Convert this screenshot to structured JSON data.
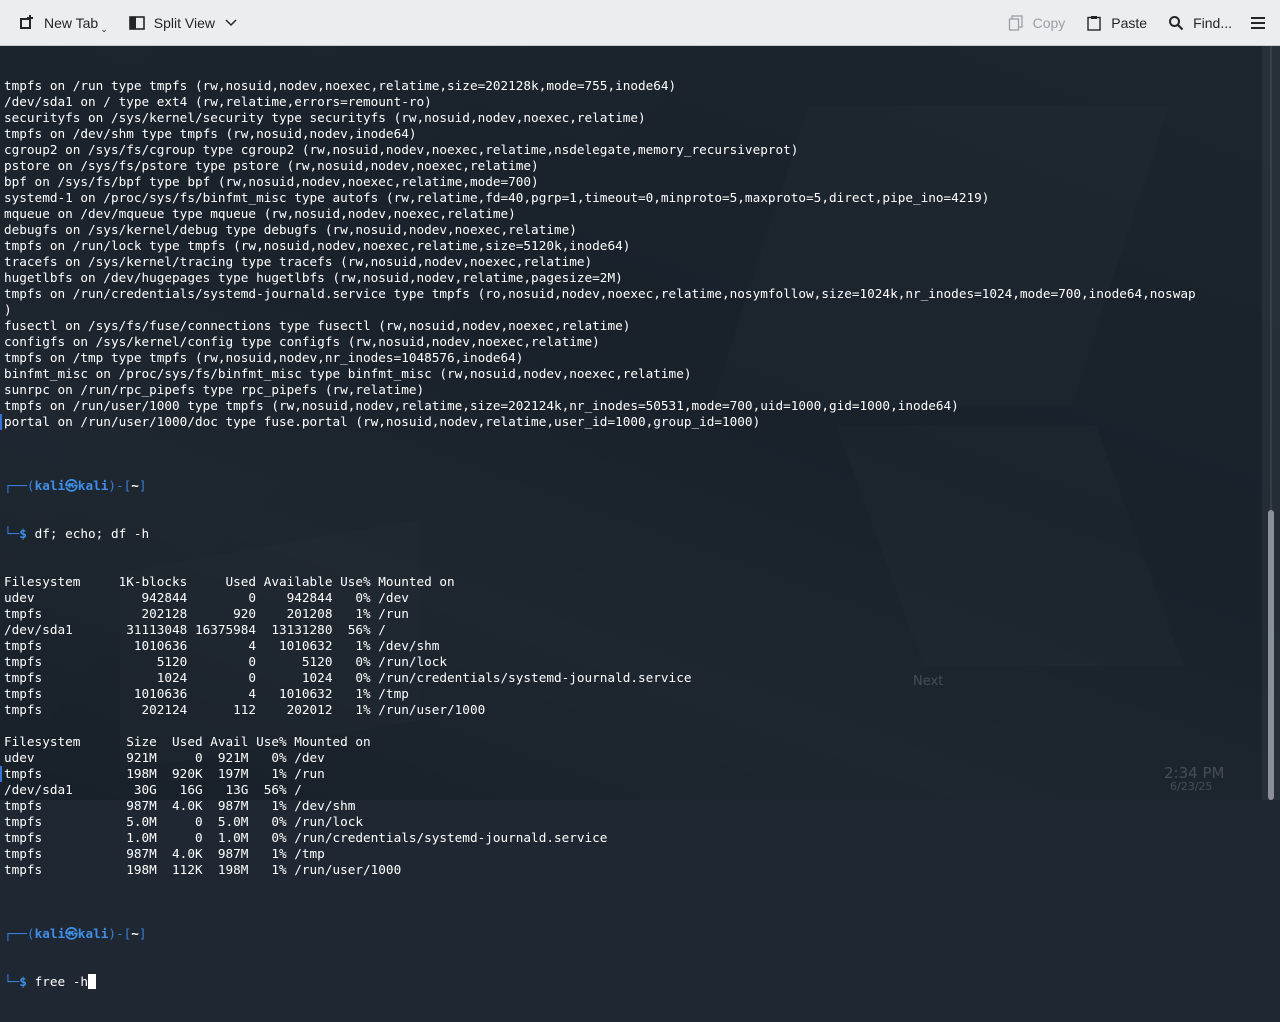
{
  "toolbar": {
    "new_tab": "New Tab",
    "split_view": "Split View",
    "copy": "Copy",
    "paste": "Paste",
    "find": "Find..."
  },
  "terminal": {
    "lines": [
      "tmpfs on /run type tmpfs (rw,nosuid,nodev,noexec,relatime,size=202128k,mode=755,inode64)",
      "/dev/sda1 on / type ext4 (rw,relatime,errors=remount-ro)",
      "securityfs on /sys/kernel/security type securityfs (rw,nosuid,nodev,noexec,relatime)",
      "tmpfs on /dev/shm type tmpfs (rw,nosuid,nodev,inode64)",
      "cgroup2 on /sys/fs/cgroup type cgroup2 (rw,nosuid,nodev,noexec,relatime,nsdelegate,memory_recursiveprot)",
      "pstore on /sys/fs/pstore type pstore (rw,nosuid,nodev,noexec,relatime)",
      "bpf on /sys/fs/bpf type bpf (rw,nosuid,nodev,noexec,relatime,mode=700)",
      "systemd-1 on /proc/sys/fs/binfmt_misc type autofs (rw,relatime,fd=40,pgrp=1,timeout=0,minproto=5,maxproto=5,direct,pipe_ino=4219)",
      "mqueue on /dev/mqueue type mqueue (rw,nosuid,nodev,noexec,relatime)",
      "debugfs on /sys/kernel/debug type debugfs (rw,nosuid,nodev,noexec,relatime)",
      "tmpfs on /run/lock type tmpfs (rw,nosuid,nodev,noexec,relatime,size=5120k,inode64)",
      "tracefs on /sys/kernel/tracing type tracefs (rw,nosuid,nodev,noexec,relatime)",
      "hugetlbfs on /dev/hugepages type hugetlbfs (rw,nosuid,nodev,relatime,pagesize=2M)",
      "tmpfs on /run/credentials/systemd-journald.service type tmpfs (ro,nosuid,nodev,noexec,relatime,nosymfollow,size=1024k,nr_inodes=1024,mode=700,inode64,noswap",
      ")",
      "fusectl on /sys/fs/fuse/connections type fusectl (rw,nosuid,nodev,noexec,relatime)",
      "configfs on /sys/kernel/config type configfs (rw,nosuid,nodev,noexec,relatime)",
      "tmpfs on /tmp type tmpfs (rw,nosuid,nodev,nr_inodes=1048576,inode64)",
      "binfmt_misc on /proc/sys/fs/binfmt_misc type binfmt_misc (rw,nosuid,nodev,noexec,relatime)",
      "sunrpc on /run/rpc_pipefs type rpc_pipefs (rw,relatime)",
      "tmpfs on /run/user/1000 type tmpfs (rw,nosuid,nodev,relatime,size=202124k,nr_inodes=50531,mode=700,uid=1000,gid=1000,inode64)",
      "portal on /run/user/1000/doc type fuse.portal (rw,nosuid,nodev,relatime,user_id=1000,group_id=1000)",
      ""
    ],
    "prompt1": {
      "top_prefix": "┌──(",
      "user_host": "kali㉿kali",
      "top_suffix": ")-[",
      "cwd": "~",
      "top_end": "]",
      "bottom_prefix": "└─",
      "dollar": "$ ",
      "command": "df; echo; df -h"
    },
    "output": [
      "Filesystem     1K-blocks     Used Available Use% Mounted on",
      "udev              942844        0    942844   0% /dev",
      "tmpfs             202128      920    201208   1% /run",
      "/dev/sda1       31113048 16375984  13131280  56% /",
      "tmpfs            1010636        4   1010632   1% /dev/shm",
      "tmpfs               5120        0      5120   0% /run/lock",
      "tmpfs               1024        0      1024   0% /run/credentials/systemd-journald.service",
      "tmpfs            1010636        4   1010632   1% /tmp",
      "tmpfs             202124      112    202012   1% /run/user/1000",
      "",
      "Filesystem      Size  Used Avail Use% Mounted on",
      "udev            921M     0  921M   0% /dev",
      "tmpfs           198M  920K  197M   1% /run",
      "/dev/sda1        30G   16G   13G  56% /",
      "tmpfs           987M  4.0K  987M   1% /dev/shm",
      "tmpfs           5.0M     0  5.0M   0% /run/lock",
      "tmpfs           1.0M     0  1.0M   0% /run/credentials/systemd-journald.service",
      "tmpfs           987M  4.0K  987M   1% /tmp",
      "tmpfs           198M  112K  198M   1% /run/user/1000",
      ""
    ],
    "prompt2": {
      "top_prefix": "┌──(",
      "user_host": "kali㉿kali",
      "top_suffix": ")-[",
      "cwd": "~",
      "top_end": "]",
      "bottom_prefix": "└─",
      "dollar": "$ ",
      "command": "free -h"
    }
  },
  "background": {
    "clock": "2:34 PM",
    "date": "6/23/25",
    "next": "Next"
  },
  "colors": {
    "prompt": "#3f8fe8",
    "toolbar_bg": "#ecedef"
  }
}
